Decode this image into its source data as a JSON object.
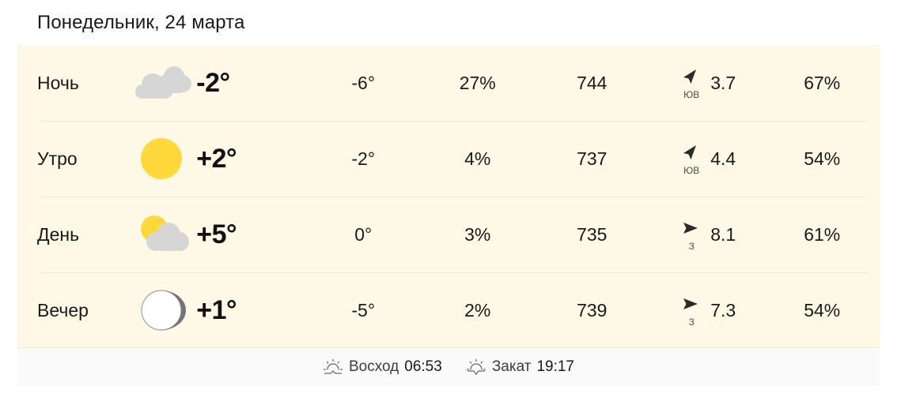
{
  "header": {
    "date_title": "Понедельник, 24 марта"
  },
  "forecast": {
    "rows": [
      {
        "part": "Ночь",
        "icon": "clouds-icon",
        "temp": "-2°",
        "feels_like": "-6°",
        "precip": "27%",
        "pressure": "744",
        "wind_dir": "ЮВ",
        "wind_dir_icon": "wind-arrow-southeast-icon",
        "wind_speed": "3.7",
        "humidity": "67%"
      },
      {
        "part": "Утро",
        "icon": "sun-icon",
        "temp": "+2°",
        "feels_like": "-2°",
        "precip": "4%",
        "pressure": "737",
        "wind_dir": "ЮВ",
        "wind_dir_icon": "wind-arrow-southeast-icon",
        "wind_speed": "4.4",
        "humidity": "54%"
      },
      {
        "part": "День",
        "icon": "sun-behind-cloud-icon",
        "temp": "+5°",
        "feels_like": "0°",
        "precip": "3%",
        "pressure": "735",
        "wind_dir": "З",
        "wind_dir_icon": "wind-arrow-west-icon",
        "wind_speed": "8.1",
        "humidity": "61%"
      },
      {
        "part": "Вечер",
        "icon": "moon-icon",
        "temp": "+1°",
        "feels_like": "-5°",
        "precip": "2%",
        "pressure": "739",
        "wind_dir": "З",
        "wind_dir_icon": "wind-arrow-west-icon",
        "wind_speed": "7.3",
        "humidity": "54%"
      }
    ]
  },
  "footer": {
    "sunrise_icon": "sunrise-icon",
    "sunrise_label": "Восход",
    "sunrise_time": "06:53",
    "sunset_icon": "sunset-icon",
    "sunset_label": "Закат",
    "sunset_time": "19:17"
  },
  "colors": {
    "card_background": "#fdf9e6",
    "footer_background": "#fafafa",
    "sun_yellow": "#ffd93b",
    "cloud_gray": "#d6d6d6",
    "moon_gray": "#737373",
    "text": "#1a1a1a",
    "divider": "#f2ecd4"
  }
}
